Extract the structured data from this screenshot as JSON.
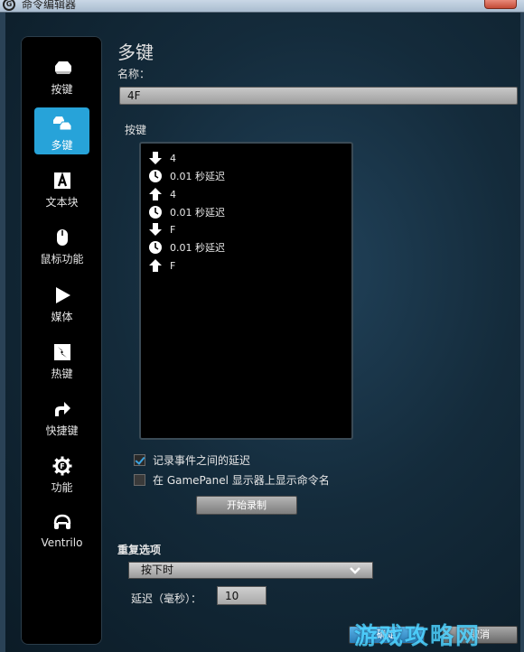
{
  "window": {
    "title": "命令编辑器"
  },
  "sidebar": {
    "items": [
      {
        "label": "按键",
        "icon": "key-icon"
      },
      {
        "label": "多键",
        "icon": "multikey-icon",
        "active": true
      },
      {
        "label": "文本块",
        "icon": "text-block-icon"
      },
      {
        "label": "鼠标功能",
        "icon": "mouse-icon"
      },
      {
        "label": "媒体",
        "icon": "play-icon"
      },
      {
        "label": "热键",
        "icon": "hotkey-icon"
      },
      {
        "label": "快捷键",
        "icon": "shortcut-arrow-icon"
      },
      {
        "label": "功能",
        "icon": "function-gear-icon"
      },
      {
        "label": "Ventrilo",
        "icon": "headset-icon"
      }
    ]
  },
  "main": {
    "title": "多键",
    "name_label": "名称：",
    "name_value": "4F",
    "keys_label": "按键",
    "key_events": [
      {
        "type": "down",
        "text": "4"
      },
      {
        "type": "delay",
        "text": "0.01 秒延迟"
      },
      {
        "type": "up",
        "text": "4"
      },
      {
        "type": "delay",
        "text": "0.01 秒延迟"
      },
      {
        "type": "down",
        "text": "F"
      },
      {
        "type": "delay",
        "text": "0.01 秒延迟"
      },
      {
        "type": "up",
        "text": "F"
      }
    ],
    "record_delays_label": "记录事件之间的延迟",
    "record_delays_checked": true,
    "show_on_gamepanel_label": "在 GamePanel 显示器上显示命令名",
    "show_on_gamepanel_checked": false,
    "record_button": "开始录制",
    "repeat_label": "重复选项",
    "repeat_value": "按下时",
    "delay_label": "延迟（毫秒）：",
    "delay_value": "10",
    "ok_button": "确定",
    "cancel_button": "取消",
    "watermark": "游戏攻略网"
  },
  "colors": {
    "accent": "#27a3d9",
    "background": "#142b3b"
  }
}
